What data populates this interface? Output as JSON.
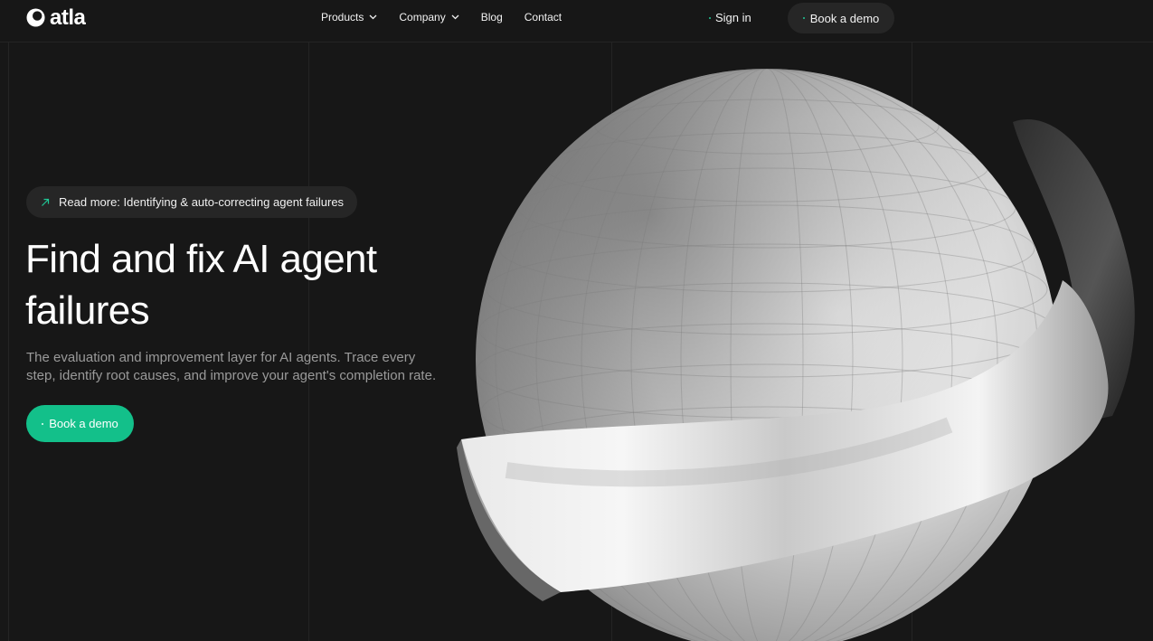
{
  "brand": {
    "name": "atla"
  },
  "nav": {
    "items": [
      {
        "label": "Products",
        "has_dropdown": true
      },
      {
        "label": "Company",
        "has_dropdown": true
      },
      {
        "label": "Blog",
        "has_dropdown": false
      },
      {
        "label": "Contact",
        "has_dropdown": false
      }
    ],
    "sign_in": "Sign in",
    "cta": "Book a demo"
  },
  "hero": {
    "announcement": "Read more: Identifying & auto-correcting agent failures",
    "title_line1": "Find and fix AI agent",
    "title_line2": "failures",
    "subtitle": "The evaluation and improvement layer for AI agents. Trace every step, identify root causes, and improve your agent's completion rate.",
    "cta": "Book a demo",
    "illustration": "sphere-with-ring-graphic"
  },
  "colors": {
    "background": "#171717",
    "accent": "#13c08a",
    "pill": "#262626",
    "muted_text": "#9a9a9a"
  },
  "icons": {
    "logo": "atla-logo-icon",
    "chevron": "chevron-down-icon",
    "announcement": "arrow-up-right-icon"
  }
}
